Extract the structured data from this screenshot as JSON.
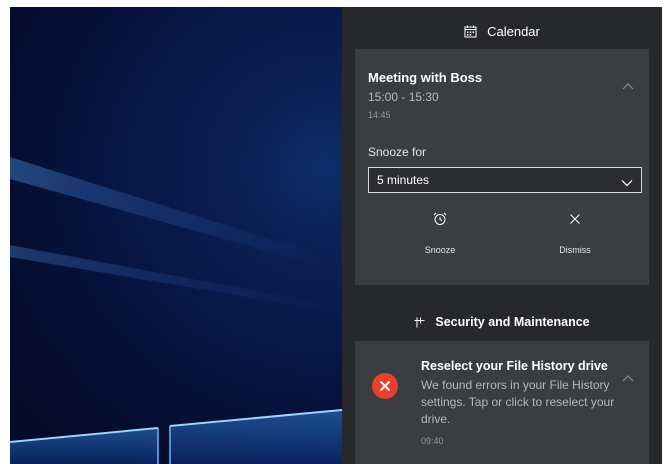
{
  "desktop": {
    "wallpaper": "windows-10-hero-light",
    "colors": {
      "bg_dark": "#050d2f",
      "bg_mid": "#0a1d4f",
      "beam": "#6fb4ff"
    }
  },
  "action_center": {
    "bg_color": "#26282b",
    "card_color": "#3b3e41",
    "groups": [
      {
        "app_name": "Calendar",
        "icon": "calendar-icon",
        "notification": {
          "title": "Meeting with Boss",
          "time_range": "15:00 - 15:30",
          "timestamp": "14:45",
          "snooze_label": "Snooze for",
          "snooze_selected": "5 minutes",
          "actions": [
            {
              "label": "Snooze",
              "icon": "alarm-clock-icon"
            },
            {
              "label": "Dismiss",
              "icon": "close-icon"
            }
          ]
        }
      },
      {
        "app_name": "Security and Maintenance",
        "icon": "flag-icon",
        "notification": {
          "title": "Reselect your File History drive",
          "body": "We found errors in your File History settings. Tap or click to reselect your drive.",
          "timestamp": "09:40",
          "status_icon": "error-icon",
          "status_color": "#e8412a"
        }
      }
    ]
  }
}
